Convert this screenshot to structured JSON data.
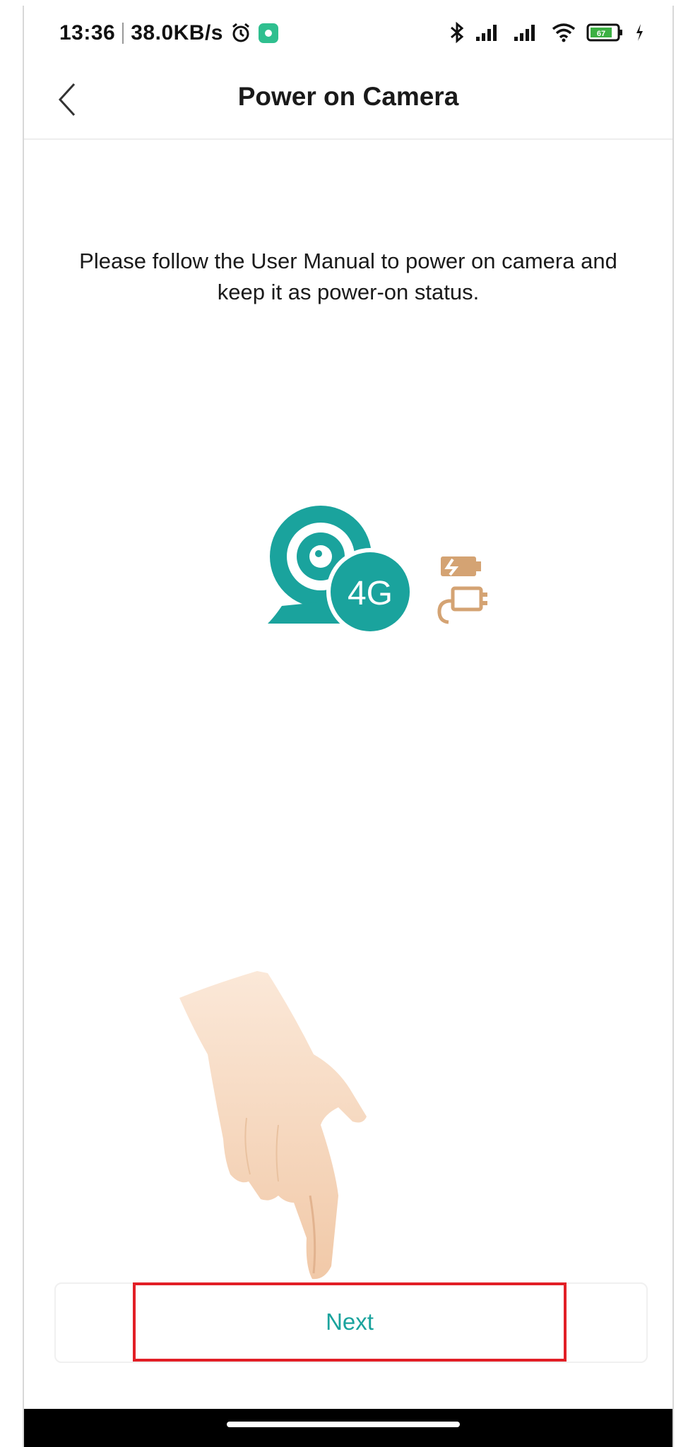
{
  "status_bar": {
    "time": "13:36",
    "network_speed": "38.0KB/s",
    "icons": [
      "alarm-icon",
      "app-notification-icon",
      "bluetooth-icon",
      "signal-icon",
      "signal-icon",
      "wifi-icon",
      "battery-icon",
      "charging-icon"
    ],
    "battery_level": "67"
  },
  "nav": {
    "back_icon": "chevron-left-icon",
    "title": "Power on Camera"
  },
  "main": {
    "instruction": "Please follow the User Manual to power on camera and keep it as power-on status.",
    "camera_badge": "4G",
    "colors": {
      "accent": "#1aa39d",
      "power_icon": "#d4a373",
      "highlight": "#e21f26"
    }
  },
  "footer": {
    "next_label": "Next"
  }
}
